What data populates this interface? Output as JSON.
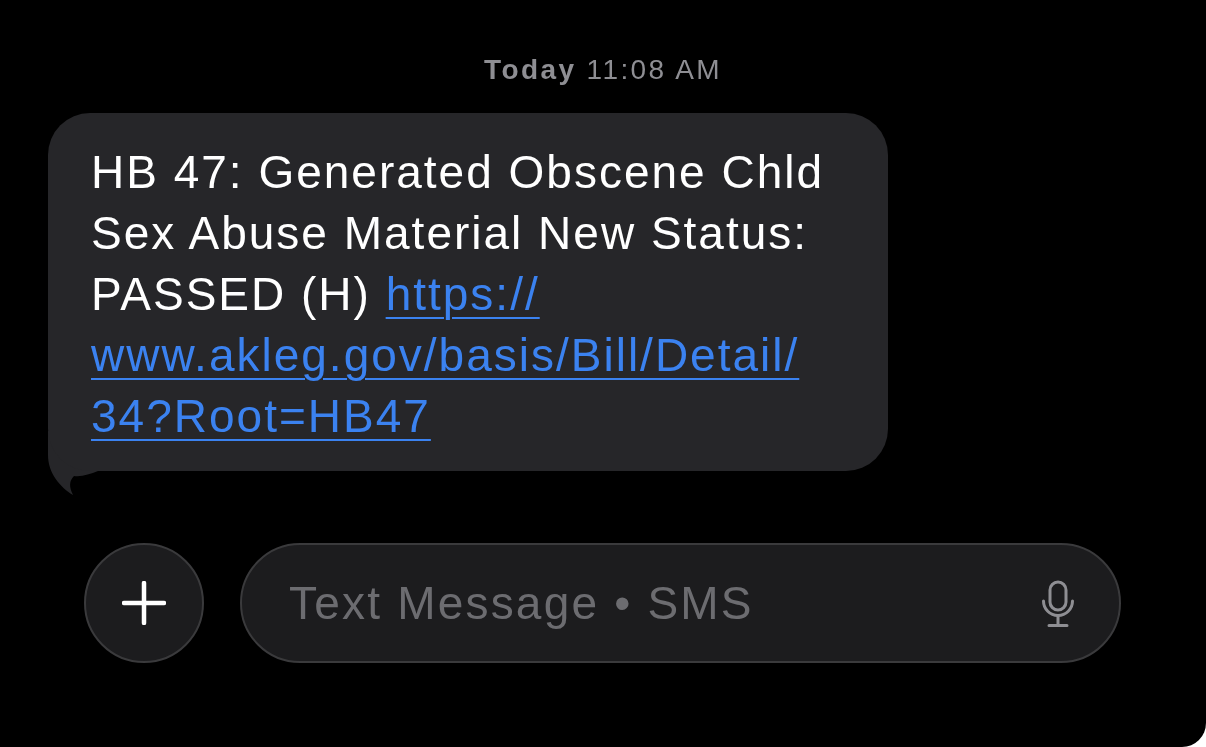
{
  "timestamp": "**Today** 11:08 AM",
  "messages": [
    {
      "kind": "incoming",
      "text": "HB 47: Generated Obscene Chld Sex Abuse Material New Status: PASSED (H)",
      "link_lines": [
        "https://",
        "www.akleg.gov/basis/Bill/Detail/",
        "34?Root=HB47"
      ]
    }
  ],
  "composer": {
    "placeholder": "Text Message • SMS"
  }
}
